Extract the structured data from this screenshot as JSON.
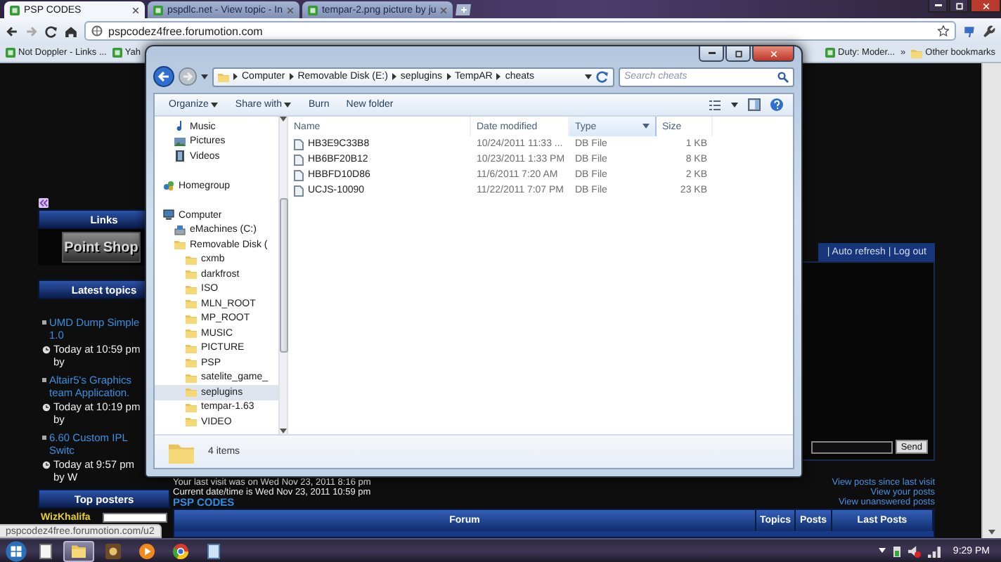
{
  "browser": {
    "tabs": [
      {
        "title": "PSP CODES",
        "selected": true
      },
      {
        "title": "pspdlc.net - View topic - In",
        "selected": false
      },
      {
        "title": "tempar-2.png picture by ju",
        "selected": false
      }
    ],
    "url": "pspcodez4free.forumotion.com",
    "bookmarks": [
      {
        "label": "Not Doppler - Links ..."
      },
      {
        "label": "Yah"
      }
    ],
    "bookmarks_right": [
      {
        "label": "Duty: Moder..."
      }
    ],
    "overflow": "»",
    "other_bookmarks": "Other bookmarks",
    "status_url": "pspcodez4free.forumotion.com/u2"
  },
  "forum": {
    "sidebar": {
      "links_title": "Links",
      "point_shop": "Point Shop",
      "latest_title": "Latest topics",
      "topics": [
        {
          "title": "UMD Dump Simple 1.0",
          "meta": "Today at 10:59 pm by"
        },
        {
          "title": "Altair5's Graphics team Application.",
          "meta": "Today at 10:19 pm by"
        },
        {
          "title": "6.60 Custom IPL Switc",
          "meta": "Today at 9:57 pm by W"
        }
      ],
      "top_title": "Top posters",
      "posters": [
        {
          "name": "WizKhalifa",
          "level": 1
        }
      ]
    },
    "account_links": "| Auto refresh | Log out",
    "send": "Send",
    "last_visit": "Your last visit was on Wed Nov 23, 2011 8:16 pm",
    "current_time": "Current date/time is Wed Nov 23, 2011 10:59 pm",
    "category": "PSP CODES",
    "quick_links": [
      "View posts since last visit",
      "View your posts",
      "View unanswered posts"
    ],
    "table_columns": [
      "Forum",
      "Topics",
      "Posts",
      "Last Posts"
    ]
  },
  "explorer": {
    "path": [
      "Computer",
      "Removable Disk (E:)",
      "seplugins",
      "TempAR",
      "cheats"
    ],
    "search_placeholder": "Search cheats",
    "toolbar": [
      {
        "label": "Organize",
        "menu": true
      },
      {
        "label": "Share with",
        "menu": true
      },
      {
        "label": "Burn",
        "menu": false
      },
      {
        "label": "New folder",
        "menu": false
      }
    ],
    "nav": {
      "libraries": [
        {
          "label": "Music",
          "kind": "music",
          "selected": false
        },
        {
          "label": "Pictures",
          "kind": "pictures",
          "selected": false
        },
        {
          "label": "Videos",
          "kind": "videos",
          "selected": false
        }
      ],
      "homegroup": {
        "label": "Homegroup",
        "kind": "homegroup",
        "selected": false
      },
      "computer": {
        "label": "Computer",
        "kind": "computer",
        "selected": false,
        "children": [
          {
            "label": "eMachines (C:)",
            "kind": "drive",
            "selected": false
          },
          {
            "label": "Removable Disk (",
            "kind": "usb",
            "selected": false,
            "children": [
              {
                "label": "cxmb",
                "kind": "folder",
                "selected": false
              },
              {
                "label": "darkfrost",
                "kind": "folder",
                "selected": false
              },
              {
                "label": "ISO",
                "kind": "folder",
                "selected": false
              },
              {
                "label": "MLN_ROOT",
                "kind": "folder",
                "selected": false
              },
              {
                "label": "MP_ROOT",
                "kind": "folder",
                "selected": false
              },
              {
                "label": "MUSIC",
                "kind": "folder",
                "selected": false
              },
              {
                "label": "PICTURE",
                "kind": "folder",
                "selected": false
              },
              {
                "label": "PSP",
                "kind": "folder",
                "selected": false
              },
              {
                "label": "satelite_game_",
                "kind": "folder",
                "selected": false
              },
              {
                "label": "seplugins",
                "kind": "folder",
                "selected": true
              },
              {
                "label": "tempar-1.63",
                "kind": "folder",
                "selected": false
              },
              {
                "label": "VIDEO",
                "kind": "folder",
                "selected": false
              }
            ]
          }
        ]
      }
    },
    "columns": [
      {
        "label": "Name",
        "highlighted": false
      },
      {
        "label": "Date modified",
        "highlighted": false
      },
      {
        "label": "Type",
        "highlighted": true
      },
      {
        "label": "Size",
        "highlighted": false
      }
    ],
    "files": [
      {
        "name": "HB3E9C33B8",
        "date": "10/24/2011 11:33 ...",
        "type": "DB File",
        "size": "1 KB"
      },
      {
        "name": "HB6BF20B12",
        "date": "10/23/2011 1:33 PM",
        "type": "DB File",
        "size": "8 KB"
      },
      {
        "name": "HBBFD10D86",
        "date": "11/6/2011 7:20 AM",
        "type": "DB File",
        "size": "2 KB"
      },
      {
        "name": "UCJS-10090",
        "date": "11/22/2011 7:07 PM",
        "type": "DB File",
        "size": "23 KB"
      }
    ],
    "status": "4 items"
  },
  "taskbar": {
    "apps": [
      {
        "kind": "notes",
        "active": false
      },
      {
        "kind": "explorer",
        "active": true
      },
      {
        "kind": "game",
        "active": false
      },
      {
        "kind": "media",
        "active": false
      },
      {
        "kind": "chrome",
        "active": false
      },
      {
        "kind": "notepad",
        "active": false
      }
    ],
    "clock": "9:29 PM"
  }
}
